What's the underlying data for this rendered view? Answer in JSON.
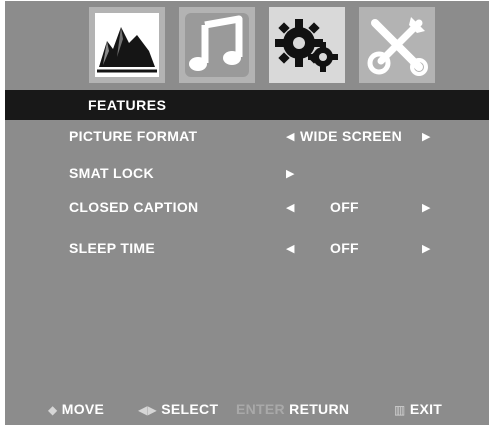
{
  "tabs": [
    {
      "icon": "picture-icon",
      "active": false
    },
    {
      "icon": "music-note-icon",
      "active": false
    },
    {
      "icon": "gears-icon",
      "active": true
    },
    {
      "icon": "tools-icon",
      "active": false
    }
  ],
  "menu": {
    "title": "FEATURES",
    "rows": [
      {
        "label": "PICTURE FORMAT",
        "left_arrow": "◀",
        "value": "WIDE SCREEN",
        "right_arrow": "▶"
      },
      {
        "label": "SMAT LOCK",
        "left_arrow": "",
        "value": "",
        "right_arrow": "▶"
      },
      {
        "label": "CLOSED CAPTION",
        "left_arrow": "◀",
        "value": "OFF",
        "right_arrow": "▶"
      },
      {
        "label": "SLEEP TIME",
        "left_arrow": "◀",
        "value": "OFF",
        "right_arrow": "▶"
      }
    ]
  },
  "footer": {
    "move_icon": "◆",
    "move_label": "MOVE",
    "select_icon": "◀▶",
    "select_label": "SELECT",
    "enter_label": "ENTER",
    "return_label": "RETURN",
    "exit_icon": "▥",
    "exit_label": "EXIT"
  },
  "colors": {
    "panel_bg": "#8c8c8c",
    "title_bar": "#181818",
    "active_tile": "#d9d9d9",
    "tile": "#b3b3b3",
    "text": "#ffffff"
  }
}
